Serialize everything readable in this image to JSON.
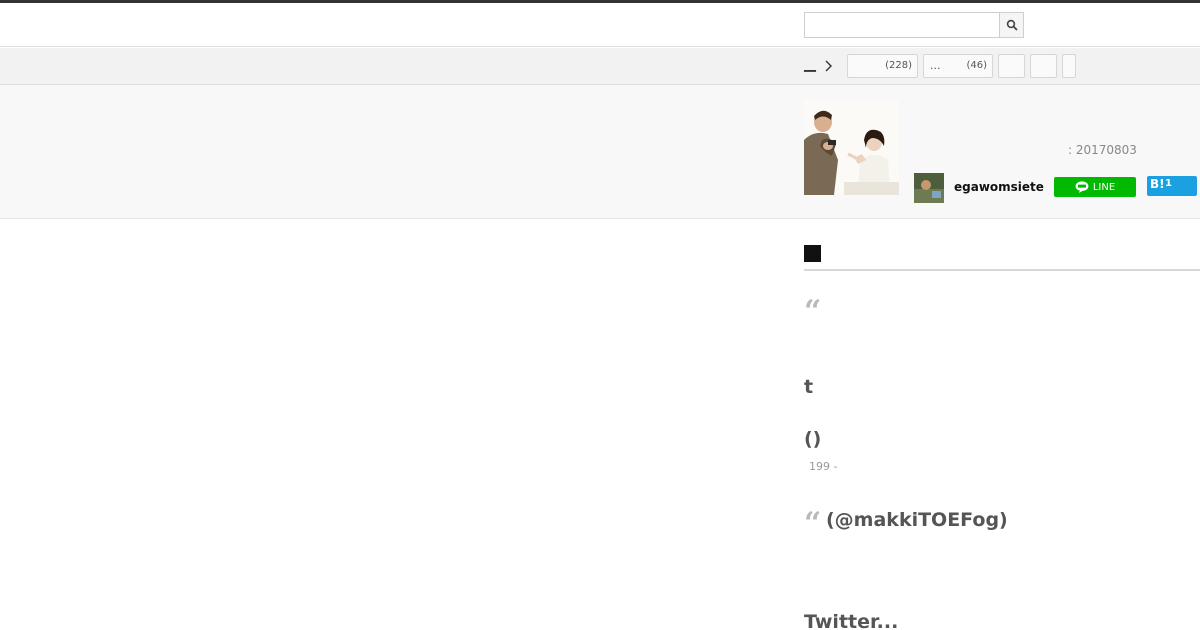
{
  "header": {
    "search_placeholder": ""
  },
  "nav": {
    "breadcrumb_home": "__",
    "categories": [
      {
        "label": "",
        "count": "(228)"
      },
      {
        "label": "...",
        "count": "(46)"
      },
      {
        "label": "",
        "count": ""
      },
      {
        "label": "",
        "count": ""
      },
      {
        "label": "",
        "count": ""
      }
    ]
  },
  "article": {
    "date": ": 20170803",
    "author": "egawomsiete",
    "line_label": "LINE",
    "hatena_label": "B!",
    "hatena_count": "1"
  },
  "body": {
    "section_heading": "",
    "quote1_mark": "“",
    "line_t": "t",
    "line_paren": "()",
    "small_line": "199 -",
    "quote2_mark": "“",
    "quote2_text": "(@makkiTOEFog)",
    "twitter_text": "Twitter..."
  },
  "colors": {
    "line_green": "#00b900",
    "hatena_blue": "#1ba1e1",
    "topbar": "#333333"
  }
}
